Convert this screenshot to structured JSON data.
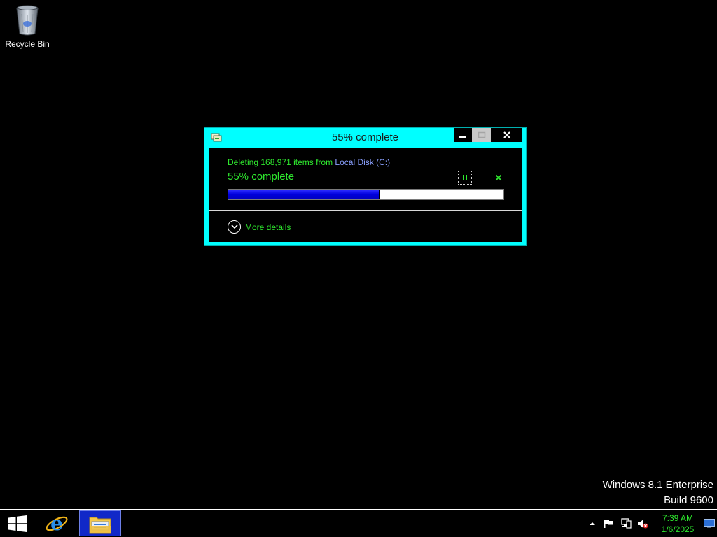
{
  "desktop": {
    "icons": [
      {
        "label": "Recycle Bin",
        "icon": "recycle-bin-icon"
      }
    ],
    "watermark": {
      "edition": "Windows 8.1 Enterprise",
      "build": "Build 9600"
    }
  },
  "dialog": {
    "title": "55% complete",
    "status_prefix": "Deleting 168,971 items from ",
    "status_source": "Local Disk (C:)",
    "percent_text": "55% complete",
    "progress": 0.55,
    "more_details_label": "More details",
    "controls": {
      "minimize": "minimize-icon",
      "maximize": "maximize-icon",
      "close": "close-icon",
      "pause": "pause-icon",
      "cancel": "cancel-icon"
    }
  },
  "taskbar": {
    "start": "windows-logo-icon",
    "pinned": [
      {
        "name": "Internet Explorer",
        "icon": "internet-explorer-icon"
      },
      {
        "name": "File Explorer",
        "icon": "file-explorer-icon",
        "active": true
      }
    ],
    "tray": {
      "icons": [
        "show-hidden-icons-icon",
        "action-center-flag-icon",
        "network-icon",
        "volume-muted-icon"
      ],
      "time": "7:39 AM",
      "date": "1/6/2025"
    }
  },
  "colors": {
    "window_frame": "#00ffff",
    "text_accent": "#2ee82e",
    "progress_fill": "#0000dd",
    "taskbar_active": "#1028c8"
  }
}
